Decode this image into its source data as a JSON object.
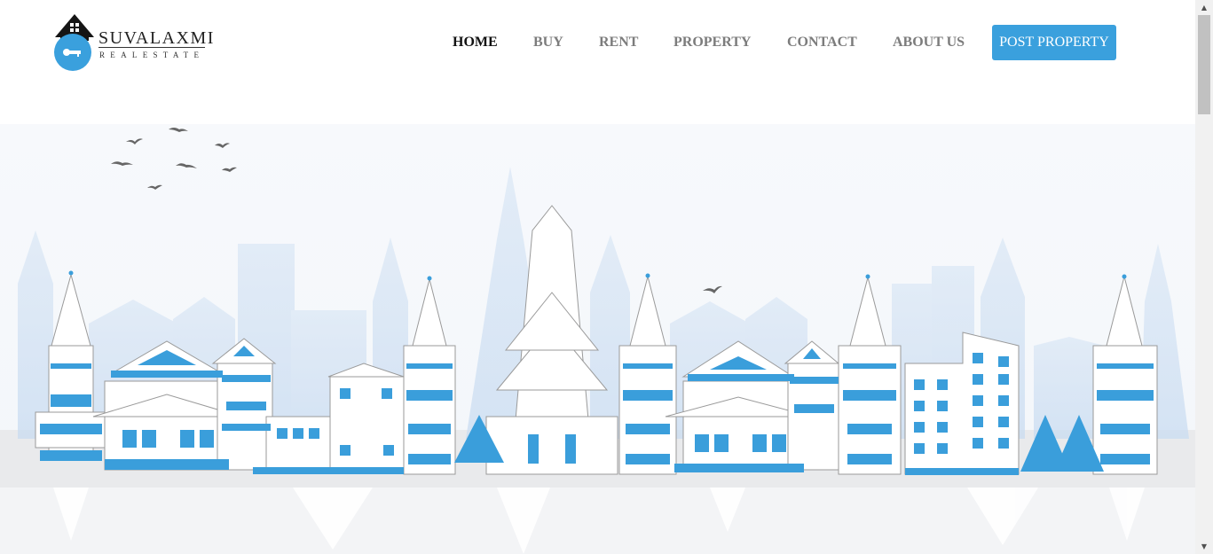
{
  "brand": {
    "name": "SUVALAXMI",
    "tagline": "REALESTATE"
  },
  "nav": {
    "items": [
      {
        "label": "HOME",
        "active": true
      },
      {
        "label": "BUY",
        "active": false
      },
      {
        "label": "RENT",
        "active": false
      },
      {
        "label": "PROPERTY",
        "active": false
      },
      {
        "label": "CONTACT",
        "active": false
      },
      {
        "label": "ABOUT US",
        "active": false
      }
    ],
    "cta_label": "POST PROPERTY"
  },
  "colors": {
    "accent": "#3aa0dd",
    "silhouette_light": "#d6e4f4",
    "reflection": "#e6e8ea",
    "bird": "#666666"
  },
  "icons": {
    "logo": "house-key-icon",
    "scroll_up": "scroll-up-arrow-icon",
    "scroll_down": "scroll-down-arrow-icon"
  }
}
